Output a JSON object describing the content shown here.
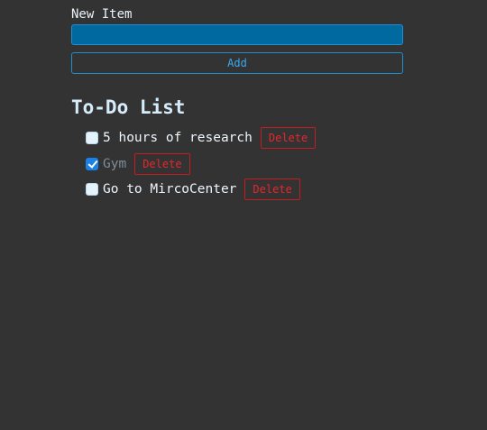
{
  "form": {
    "label": "New Item",
    "input_value": "",
    "add_label": "Add"
  },
  "list": {
    "title": "To-Do List",
    "items": [
      {
        "text": "5 hours of research",
        "checked": false,
        "delete_label": "Delete"
      },
      {
        "text": "Gym",
        "checked": true,
        "delete_label": "Delete"
      },
      {
        "text": "Go to MircoCenter",
        "checked": false,
        "delete_label": "Delete"
      }
    ]
  },
  "colors": {
    "background": "#333333",
    "accent": "#1f8fd4",
    "input_fill": "#006aa0",
    "danger": "#e8262c"
  }
}
